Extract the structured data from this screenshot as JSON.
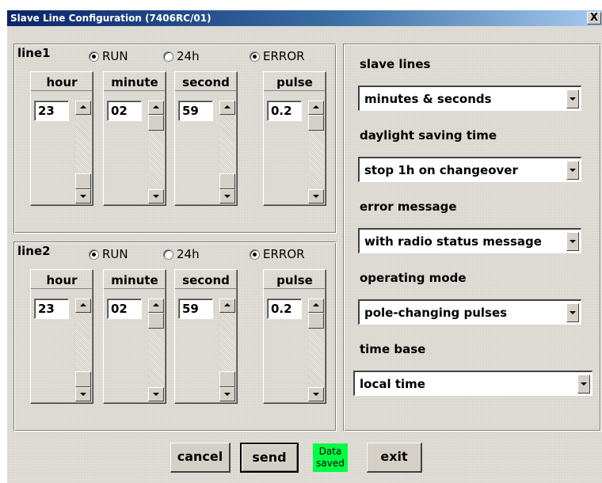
{
  "window": {
    "title": "Slave Line Configuration (7406RC/01)",
    "close_label": "X"
  },
  "lines": [
    {
      "title": "line1",
      "radios": [
        {
          "label": "RUN",
          "checked": true
        },
        {
          "label": "24h",
          "checked": false
        },
        {
          "label": "ERROR",
          "checked": true
        }
      ],
      "fields": [
        {
          "label": "hour",
          "value": "23"
        },
        {
          "label": "minute",
          "value": "02"
        },
        {
          "label": "second",
          "value": "59"
        },
        {
          "label": "pulse",
          "value": "0.2"
        }
      ]
    },
    {
      "title": "line2",
      "radios": [
        {
          "label": "RUN",
          "checked": true
        },
        {
          "label": "24h",
          "checked": false
        },
        {
          "label": "ERROR",
          "checked": true
        }
      ],
      "fields": [
        {
          "label": "hour",
          "value": "23"
        },
        {
          "label": "minute",
          "value": "02"
        },
        {
          "label": "second",
          "value": "59"
        },
        {
          "label": "pulse",
          "value": "0.2"
        }
      ]
    }
  ],
  "settings": [
    {
      "label": "slave lines",
      "value": "minutes & seconds"
    },
    {
      "label": "daylight saving time",
      "value": "stop 1h on changeover"
    },
    {
      "label": "error message",
      "value": "with radio status message"
    },
    {
      "label": "operating mode",
      "value": "pole-changing pulses"
    },
    {
      "label": "time base",
      "value": "local time"
    }
  ],
  "buttons": {
    "cancel": "cancel",
    "send": "send",
    "exit": "exit"
  },
  "status": {
    "line1": "Data",
    "line2": "saved",
    "color": "#00ff44"
  }
}
